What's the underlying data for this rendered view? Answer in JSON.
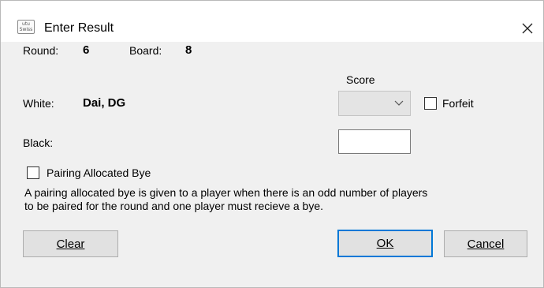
{
  "window": {
    "title": "Enter Result",
    "icon_lines": [
      "utu",
      "Swiss"
    ]
  },
  "round": {
    "label": "Round:",
    "value": "6"
  },
  "board": {
    "label": "Board:",
    "value": "8"
  },
  "white": {
    "label": "White:",
    "value": "Dai, DG"
  },
  "black": {
    "label": "Black:",
    "value": ""
  },
  "score": {
    "label": "Score",
    "selected": ""
  },
  "forfeit": {
    "label": "Forfeit",
    "checked": false
  },
  "bye": {
    "label": "Pairing Allocated Bye",
    "checked": false,
    "info_line1": "A pairing allocated bye is given to a player when there is an odd number of players",
    "info_line2": "to be paired for the round and one player must recieve a bye."
  },
  "buttons": {
    "clear": "Clear",
    "ok": "OK",
    "cancel": "Cancel"
  },
  "icons": {
    "close": "close-icon",
    "dropdown": "chevron-down-icon",
    "app": "app-icon"
  }
}
